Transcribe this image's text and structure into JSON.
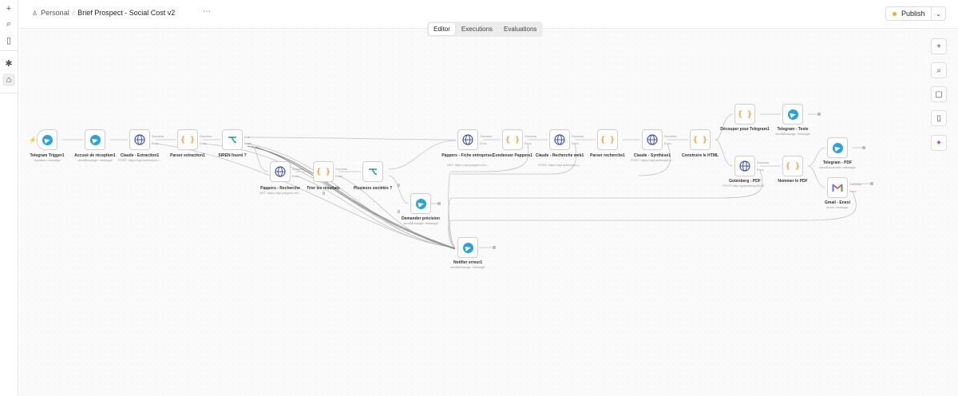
{
  "rail": {
    "add": "+",
    "search": "⌕",
    "panel": "▯",
    "templates": "✱",
    "home": "⌂"
  },
  "header": {
    "project": "Personal",
    "title": "Brief Prospect - Social Cost v2",
    "more": "⋯",
    "publish": "Publish",
    "publish_menu": "⌄"
  },
  "tabs": [
    {
      "label": "Editor",
      "active": true
    },
    {
      "label": "Executions",
      "active": false
    },
    {
      "label": "Evaluations",
      "active": false
    }
  ],
  "tools": {
    "zoom_in": "+",
    "zoom_search": "⌕",
    "sticky": "▢",
    "panel": "▯",
    "ai": "✦"
  },
  "colors": {
    "telegram": "#2aa3dc",
    "code": "#f39c2b",
    "http": "#3f51b5",
    "branch": "#16a085",
    "publish_dot": "#e8b21b",
    "gmail_red": "#ea4335"
  },
  "nodes": {
    "tg_trigger": {
      "label": "Telegram Trigger1",
      "sub": "Updates: message",
      "icon": "telegram-icon"
    },
    "accuse": {
      "label": "Accusé de réception1",
      "sub": "sendMessage: message",
      "icon": "telegram-icon"
    },
    "claude_extract": {
      "label": "Claude - Extraction1",
      "sub": "POST: https://api.anthropic.c...",
      "icon": "globe-icon"
    },
    "parser_extract": {
      "label": "Parser extraction1",
      "sub": "",
      "icon": "code-braces-icon"
    },
    "siren": {
      "label": "SIREN fourni ?",
      "sub": "",
      "icon": "branch-icon",
      "out_true": "true",
      "out_false": "false"
    },
    "pappers_recherche": {
      "label": "Pappers - Recherche",
      "sub": "GET: https://api.pappers.fr/v...",
      "icon": "globe-icon"
    },
    "trier": {
      "label": "Trier les résultats",
      "sub": "",
      "icon": "code-braces-icon"
    },
    "plusieurs": {
      "label": "Plusieurs sociétés ?",
      "sub": "",
      "icon": "branch-icon"
    },
    "demander": {
      "label": "Demander précision",
      "sub": "sendMessage: message",
      "icon": "telegram-icon"
    },
    "notifier": {
      "label": "Notifier erreur1",
      "sub": "sendMessage: message",
      "icon": "telegram-icon"
    },
    "pappers_fiche": {
      "label": "Pappers - Fiche entreprise1",
      "sub": "GET: https://api.pappers.fr/v...",
      "icon": "globe-icon"
    },
    "condenser": {
      "label": "Condenser Pappers1",
      "sub": "",
      "icon": "code-braces-icon"
    },
    "claude_web": {
      "label": "Claude - Recherche web1",
      "sub": "POST: https://api.anthropic.c...",
      "icon": "globe-icon"
    },
    "parser_recherche": {
      "label": "Parser recherche1",
      "sub": "",
      "icon": "code-braces-icon"
    },
    "claude_synthese": {
      "label": "Claude - Synthèse1",
      "sub": "POST: https://api.anthropic.c...",
      "icon": "globe-icon"
    },
    "construire": {
      "label": "Construire le HTML",
      "sub": "",
      "icon": "code-braces-icon"
    },
    "decouper": {
      "label": "Découper pour Telegram1",
      "sub": "",
      "icon": "code-braces-icon"
    },
    "tg_texte": {
      "label": "Telegram - Texte",
      "sub": "sendMessage: message",
      "icon": "telegram-icon"
    },
    "gotenberg": {
      "label": "Gotenberg - PDF",
      "sub": "POST: http://gotenberg:3000/...",
      "icon": "globe-icon"
    },
    "nommer": {
      "label": "Nommer le PDF",
      "sub": "",
      "icon": "code-braces-icon"
    },
    "tg_pdf": {
      "label": "Telegram - PDF",
      "sub": "sendDocument: message",
      "icon": "telegram-icon"
    },
    "gmail": {
      "label": "Gmail - Envoi",
      "sub": "send: message",
      "icon": "gmail-icon"
    }
  },
  "port_labels": {
    "success": "Success",
    "error": "Error",
    "true": "true",
    "false": "false"
  },
  "counts": {
    "c1": "0",
    "c2": "0",
    "c3": "0"
  }
}
